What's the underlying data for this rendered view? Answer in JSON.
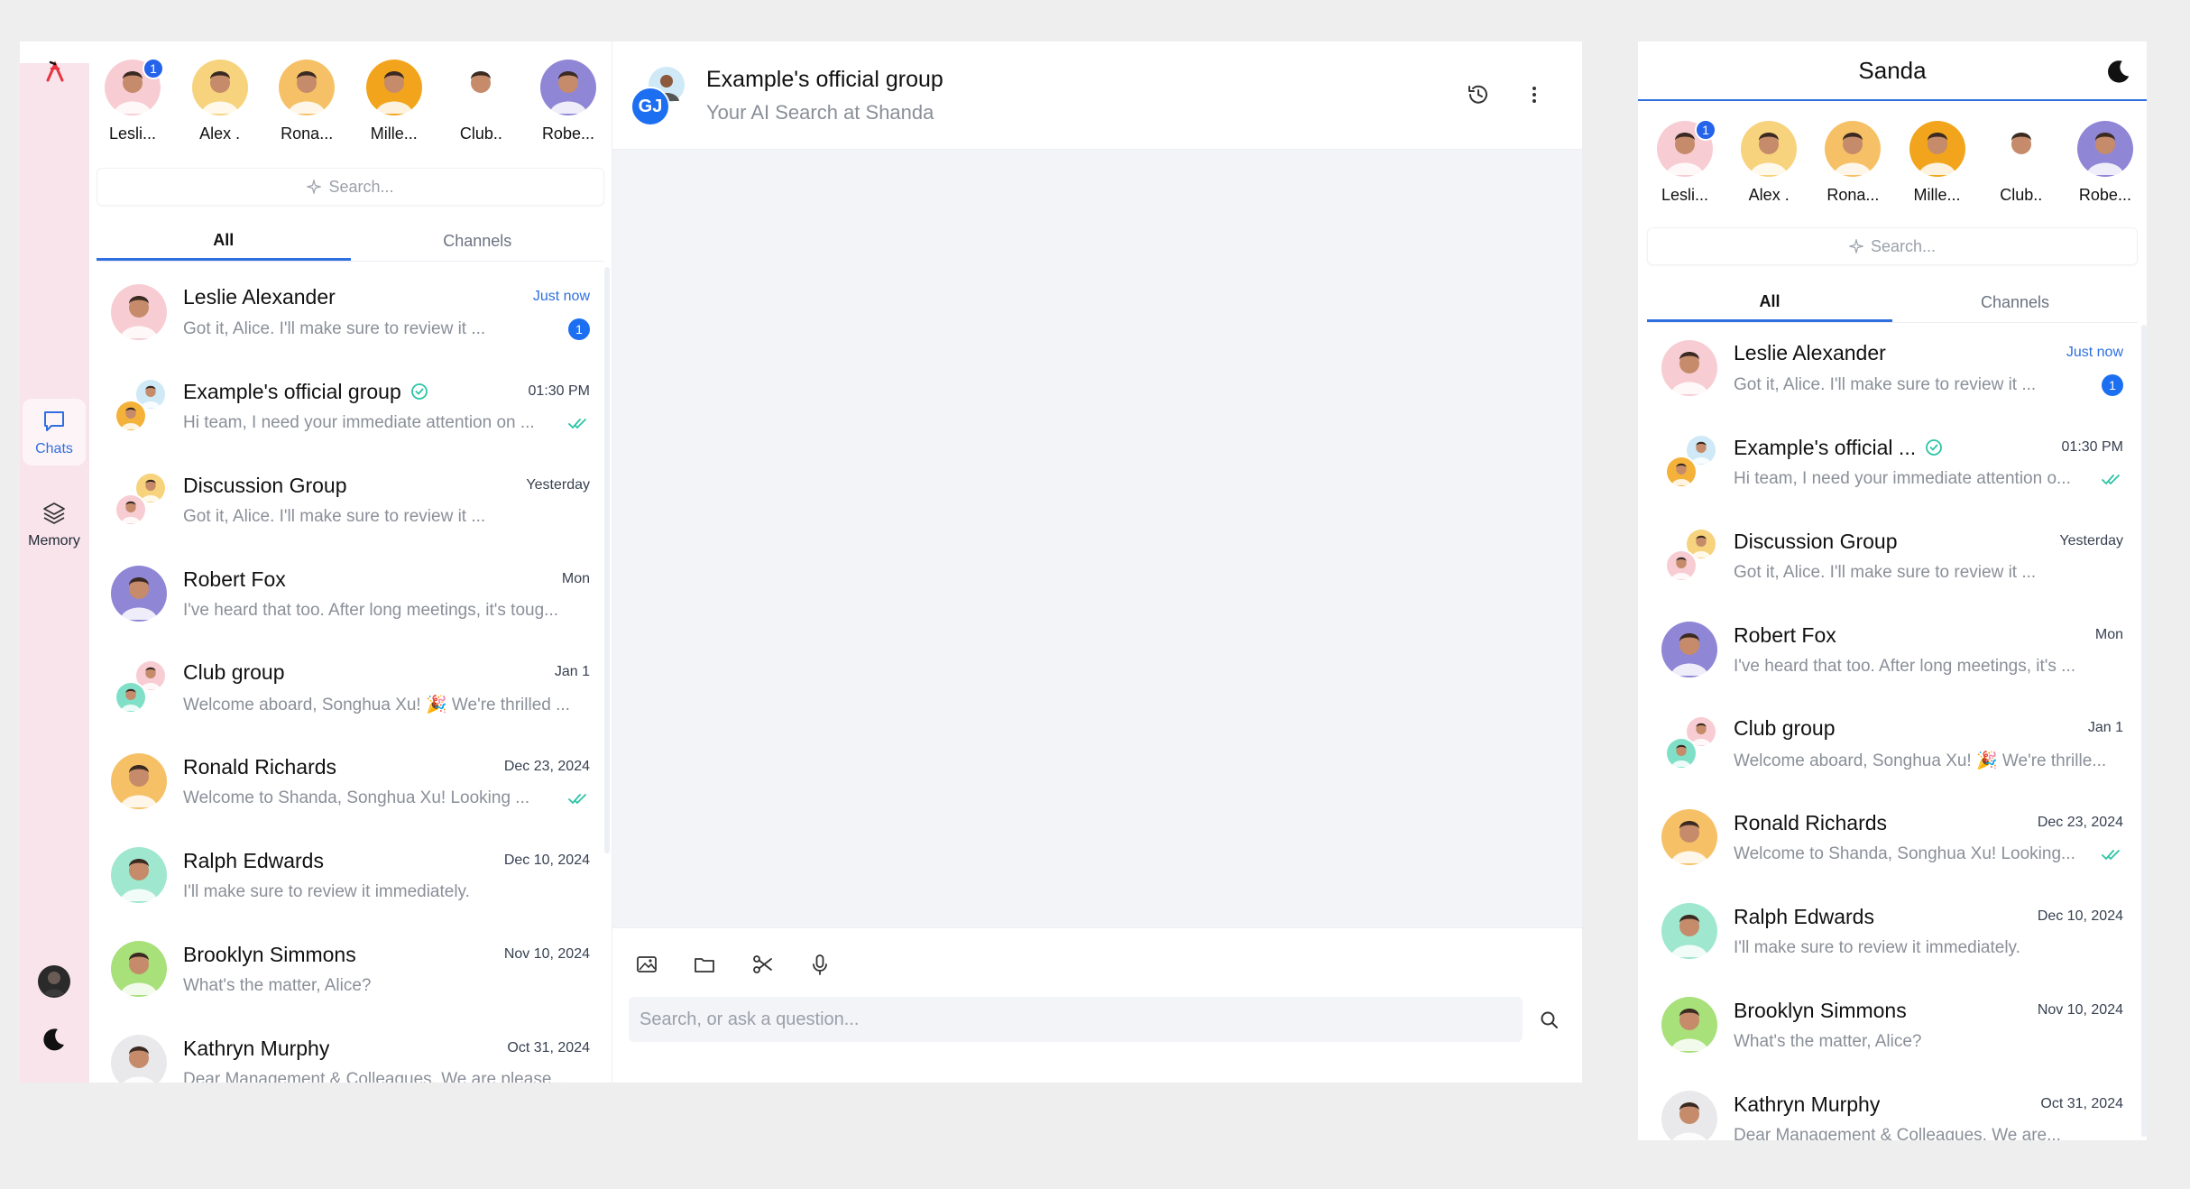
{
  "colors": {
    "accent": "#2f6fe0",
    "rail_bg": "#f8e4ea",
    "chat_bg": "#f2f4f8",
    "unread": "#1d6ff2",
    "verified": "#2bc4a5"
  },
  "rail": {
    "chats_label": "Chats",
    "memory_label": "Memory"
  },
  "stories": [
    {
      "label": "Lesli...",
      "badge": "1",
      "color": "#f7cdd3"
    },
    {
      "label": "Alex .",
      "badge": "",
      "color": "#f6d37c"
    },
    {
      "label": "Rona...",
      "badge": "",
      "color": "#f6c166"
    },
    {
      "label": "Mille...",
      "badge": "",
      "color": "#f2a51c"
    },
    {
      "label": "Club..",
      "badge": "",
      "color": "#ffffff"
    },
    {
      "label": "Robe...",
      "badge": "",
      "color": "#8f86d6"
    }
  ],
  "search": {
    "placeholder": "Search..."
  },
  "tabs": {
    "all": "All",
    "channels": "Channels"
  },
  "desktop_rows": [
    {
      "name": "Leslie Alexander",
      "time": "Just now",
      "preview": "Got it, Alice. I'll make sure to review it ...",
      "status": "unread",
      "unread": "1",
      "verified": false,
      "group": false,
      "color": "#f7cdd3",
      "color2": "",
      "time_blue": true
    },
    {
      "name": "Example's official group",
      "time": "01:30 PM",
      "preview": "Hi team, I need your immediate attention on ...",
      "status": "read",
      "unread": "",
      "verified": true,
      "group": true,
      "color": "#cfe9f7",
      "color2": "#f4b23a",
      "time_blue": false
    },
    {
      "name": "Discussion Group",
      "time": "Yesterday",
      "preview": "Got it, Alice. I'll make sure to review it ...",
      "status": "",
      "unread": "",
      "verified": false,
      "group": true,
      "color": "#f6d37c",
      "color2": "#f7cdd3",
      "time_blue": false
    },
    {
      "name": "Robert Fox",
      "time": "Mon",
      "preview": "I've heard that too. After long meetings, it's toug...",
      "status": "",
      "unread": "",
      "verified": false,
      "group": false,
      "color": "#8f86d6",
      "color2": "",
      "time_blue": false
    },
    {
      "name": "Club group",
      "time": "Jan 1",
      "preview": "Welcome aboard, Songhua Xu! 🎉 We're thrilled ...",
      "status": "",
      "unread": "",
      "verified": false,
      "group": true,
      "color": "#f7cdd3",
      "color2": "#7fe0c7",
      "time_blue": false
    },
    {
      "name": "Ronald Richards",
      "time": "Dec 23, 2024",
      "preview": "Welcome to Shanda, Songhua Xu! Looking ...",
      "status": "read",
      "unread": "",
      "verified": false,
      "group": false,
      "color": "#f6c166",
      "color2": "",
      "time_blue": false
    },
    {
      "name": "Ralph Edwards",
      "time": "Dec 10, 2024",
      "preview": "I'll make sure to review it immediately.",
      "status": "",
      "unread": "",
      "verified": false,
      "group": false,
      "color": "#9fe7cf",
      "color2": "",
      "time_blue": false
    },
    {
      "name": "Brooklyn Simmons",
      "time": "Nov 10, 2024",
      "preview": "What's the matter, Alice?",
      "status": "",
      "unread": "",
      "verified": false,
      "group": false,
      "color": "#a8e07a",
      "color2": "",
      "time_blue": false
    },
    {
      "name": "Kathryn Murphy",
      "time": "Oct 31, 2024",
      "preview": "Dear Management & Colleagues,  We are please...",
      "status": "",
      "unread": "",
      "verified": false,
      "group": false,
      "color": "#e9e9ec",
      "color2": "",
      "time_blue": false
    }
  ],
  "mobile_rows": [
    {
      "name": "Leslie Alexander",
      "time": "Just now",
      "preview": "Got it, Alice. I'll make sure to review it ...",
      "status": "unread",
      "unread": "1",
      "verified": false,
      "group": false,
      "color": "#f7cdd3",
      "color2": "",
      "time_blue": true
    },
    {
      "name": "Example's official ...",
      "time": "01:30 PM",
      "preview": "Hi team, I need your immediate attention o...",
      "status": "read",
      "unread": "",
      "verified": true,
      "group": true,
      "color": "#cfe9f7",
      "color2": "#f4b23a",
      "time_blue": false
    },
    {
      "name": "Discussion Group",
      "time": "Yesterday",
      "preview": "Got it, Alice. I'll make sure to review it ...",
      "status": "",
      "unread": "",
      "verified": false,
      "group": true,
      "color": "#f6d37c",
      "color2": "#f7cdd3",
      "time_blue": false
    },
    {
      "name": "Robert Fox",
      "time": "Mon",
      "preview": "I've heard that too. After long meetings, it's ...",
      "status": "",
      "unread": "",
      "verified": false,
      "group": false,
      "color": "#8f86d6",
      "color2": "",
      "time_blue": false
    },
    {
      "name": "Club group",
      "time": "Jan 1",
      "preview": "Welcome aboard, Songhua Xu! 🎉 We're thrille...",
      "status": "",
      "unread": "",
      "verified": false,
      "group": true,
      "color": "#f7cdd3",
      "color2": "#7fe0c7",
      "time_blue": false
    },
    {
      "name": "Ronald Richards",
      "time": "Dec 23, 2024",
      "preview": "Welcome to Shanda, Songhua Xu! Looking...",
      "status": "read",
      "unread": "",
      "verified": false,
      "group": false,
      "color": "#f6c166",
      "color2": "",
      "time_blue": false
    },
    {
      "name": "Ralph Edwards",
      "time": "Dec 10, 2024",
      "preview": "I'll make sure to review it immediately.",
      "status": "",
      "unread": "",
      "verified": false,
      "group": false,
      "color": "#9fe7cf",
      "color2": "",
      "time_blue": false
    },
    {
      "name": "Brooklyn Simmons",
      "time": "Nov 10, 2024",
      "preview": "What's the matter, Alice?",
      "status": "",
      "unread": "",
      "verified": false,
      "group": false,
      "color": "#a8e07a",
      "color2": "",
      "time_blue": false
    },
    {
      "name": "Kathryn Murphy",
      "time": "Oct 31, 2024",
      "preview": "Dear Management & Colleagues,  We are...",
      "status": "",
      "unread": "",
      "verified": false,
      "group": false,
      "color": "#e9e9ec",
      "color2": "",
      "time_blue": false
    }
  ],
  "chat": {
    "title": "Example's official group",
    "subtitle": "Your AI Search at Shanda",
    "avatar_initials": "GJ",
    "composer_placeholder": "Search, or ask a question..."
  },
  "mobile": {
    "title": "Sanda"
  }
}
